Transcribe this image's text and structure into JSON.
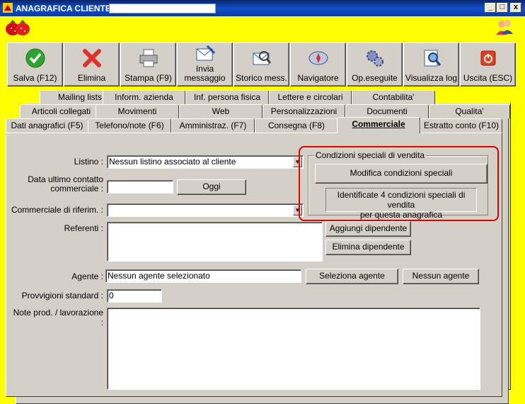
{
  "window": {
    "title": "ANAGRAFICA CLIENTE -",
    "title_field_value": "",
    "controls": {
      "minimize": "_",
      "maximize": "□",
      "close": "x"
    }
  },
  "colors": {
    "background": "#ffff00",
    "titlebar": "#0a246a",
    "highlight": "#e00000"
  },
  "toolbar": [
    {
      "label": "Salva (F12)",
      "icon": "check-icon"
    },
    {
      "label": "Elimina",
      "icon": "delete-x-icon"
    },
    {
      "label": "Stampa (F9)",
      "icon": "printer-icon"
    },
    {
      "label": "Invia messaggio",
      "icon": "send-message-icon"
    },
    {
      "label": "Storico mess.",
      "icon": "message-history-icon"
    },
    {
      "label": "Navigatore",
      "icon": "navigator-icon"
    },
    {
      "label": "Op.eseguite",
      "icon": "gears-icon"
    },
    {
      "label": "Visualizza log",
      "icon": "view-log-icon"
    },
    {
      "label": "Uscita (ESC)",
      "icon": "exit-icon"
    }
  ],
  "tabs": {
    "row1": [
      "Mailing lists",
      "Inform. azienda",
      "Inf. persona fisica",
      "Lettere e circolari",
      "Contabilita'"
    ],
    "row2": [
      "Articoli collegati",
      "Movimenti",
      "Web",
      "Personalizzazioni",
      "Documenti",
      "Qualita'"
    ],
    "row3": [
      "Dati anagrafici (F5)",
      "Telefono/note (F6)",
      "Amministraz. (F7)",
      "Consegna (F8)",
      "Commerciale",
      "Estratto conto (F10)"
    ]
  },
  "form": {
    "listino_label": "Listino :",
    "listino_value": "Nessun listino associato al cliente",
    "data_contatto_label": "Data ultimo contatto commerciale :",
    "data_contatto_value": "",
    "oggi_button": "Oggi",
    "commerciale_label": "Commerciale di riferim. :",
    "commerciale_value": "",
    "referenti_label": "Referenti :",
    "aggiungi_button": "Aggiungi dipendente",
    "elimina_dip_button": "Elimina dipendente",
    "agente_label": "Agente :",
    "agente_value": "Nessun agente selezionato",
    "seleziona_agente_button": "Seleziona agente",
    "nessun_agente_button": "Nessun agente",
    "provvigioni_label": "Provvigioni standard :",
    "provvigioni_value": "0",
    "note_label": "Note prod. / lavorazione :",
    "note_value": ""
  },
  "special_conditions": {
    "group_title": "Condizioni speciali di vendita",
    "modify_button": "Modifica condizioni speciali",
    "info_line1": "Identificate 4 condizioni speciali di vendita",
    "info_line2": "per questa anagrafica"
  }
}
